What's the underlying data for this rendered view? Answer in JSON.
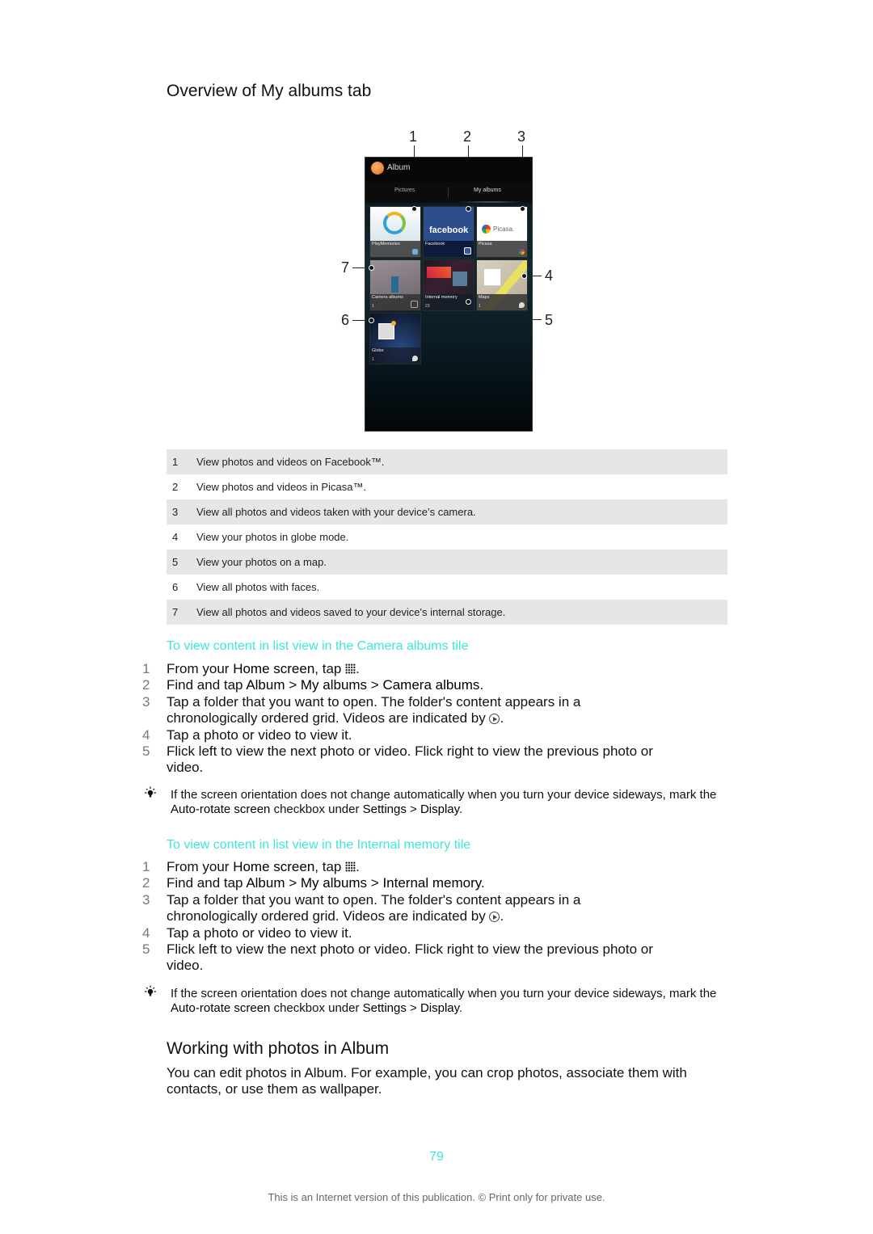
{
  "sections": {
    "overview_title": "Overview of My albums tab",
    "working_title": "Working with photos in Album"
  },
  "figure": {
    "app_title": "Album",
    "tabs": [
      "Pictures",
      "My albums"
    ],
    "callouts": [
      "1",
      "2",
      "3",
      "4",
      "5",
      "6",
      "7"
    ],
    "tiles": [
      {
        "label": "PlayMemories",
        "count": ""
      },
      {
        "label": "Facebook",
        "count": "",
        "logo": "facebook"
      },
      {
        "label": "Picasa",
        "count": "",
        "logo": "Picasa."
      },
      {
        "label": "Camera albums",
        "count": "1"
      },
      {
        "label": "Internal memory",
        "count": "23"
      },
      {
        "label": "Maps",
        "count": "1"
      },
      {
        "label": "Globe",
        "count": "1"
      }
    ]
  },
  "legend": [
    {
      "num": "1",
      "text": "View photos and videos on Facebook™."
    },
    {
      "num": "2",
      "text": "View photos and videos in Picasa™."
    },
    {
      "num": "3",
      "text": "View all photos and videos taken with your device’s camera."
    },
    {
      "num": "4",
      "text": "View your photos in globe mode."
    },
    {
      "num": "5",
      "text": "View your photos on a map."
    },
    {
      "num": "6",
      "text": "View all photos with faces."
    },
    {
      "num": "7",
      "text": "View all photos and videos saved to your device's internal storage."
    }
  ],
  "procedures": [
    {
      "title": "To view content in list view in the Camera albums tile",
      "steps": {
        "s1_pre": "From your ",
        "s1_b": "Home screen",
        "s1_post": ", tap ",
        "s1_end": ".",
        "s2_pre": "Find and tap ",
        "s2_b1": "Album",
        "s2_sep1": " > ",
        "s2_b2": "My albums",
        "s2_sep2": " > ",
        "s2_b3": "Camera albums",
        "s2_end": ".",
        "s3": "Tap a folder that you want to open. The folder's content appears in a chronologically ordered grid. Videos are indicated by ",
        "s3_end": ".",
        "s4": "Tap a photo or video to view it.",
        "s5": "Flick left to view the next photo or video. Flick right to view the previous photo or video."
      },
      "nums": [
        "1",
        "2",
        "3",
        "4",
        "5"
      ]
    },
    {
      "title": "To view content in list view in the Internal memory tile",
      "steps": {
        "s1_pre": "From your ",
        "s1_b": "Home screen",
        "s1_post": ", tap ",
        "s1_end": ".",
        "s2_pre": "Find and tap ",
        "s2_b1": "Album",
        "s2_sep1": " > ",
        "s2_b2": "My albums",
        "s2_sep2": " > ",
        "s2_b3": "Internal memory",
        "s2_end": ".",
        "s3": "Tap a folder that you want to open. The folder's content appears in a chronologically ordered grid. Videos are indicated by ",
        "s3_end": ".",
        "s4": "Tap a photo or video to view it.",
        "s5": "Flick left to view the next photo or video. Flick right to view the previous photo or video."
      },
      "nums": [
        "1",
        "2",
        "3",
        "4",
        "5"
      ]
    }
  ],
  "tip": {
    "pre": "If the screen orientation does not change automatically when you turn your device sideways, mark the ",
    "b1": "Auto-rotate screen",
    "mid": " checkbox under ",
    "b2": "Settings",
    "sep": " > ",
    "b3": "Display",
    "end": "."
  },
  "body_text": "You can edit photos in Album. For example, you can crop photos, associate them with contacts, or use them as wallpaper.",
  "page_number": "79",
  "footer": "This is an Internet version of this publication. © Print only for private use.",
  "colors": {
    "accent": "#3ee8d9",
    "shaded_row": "#e6e6e6"
  }
}
